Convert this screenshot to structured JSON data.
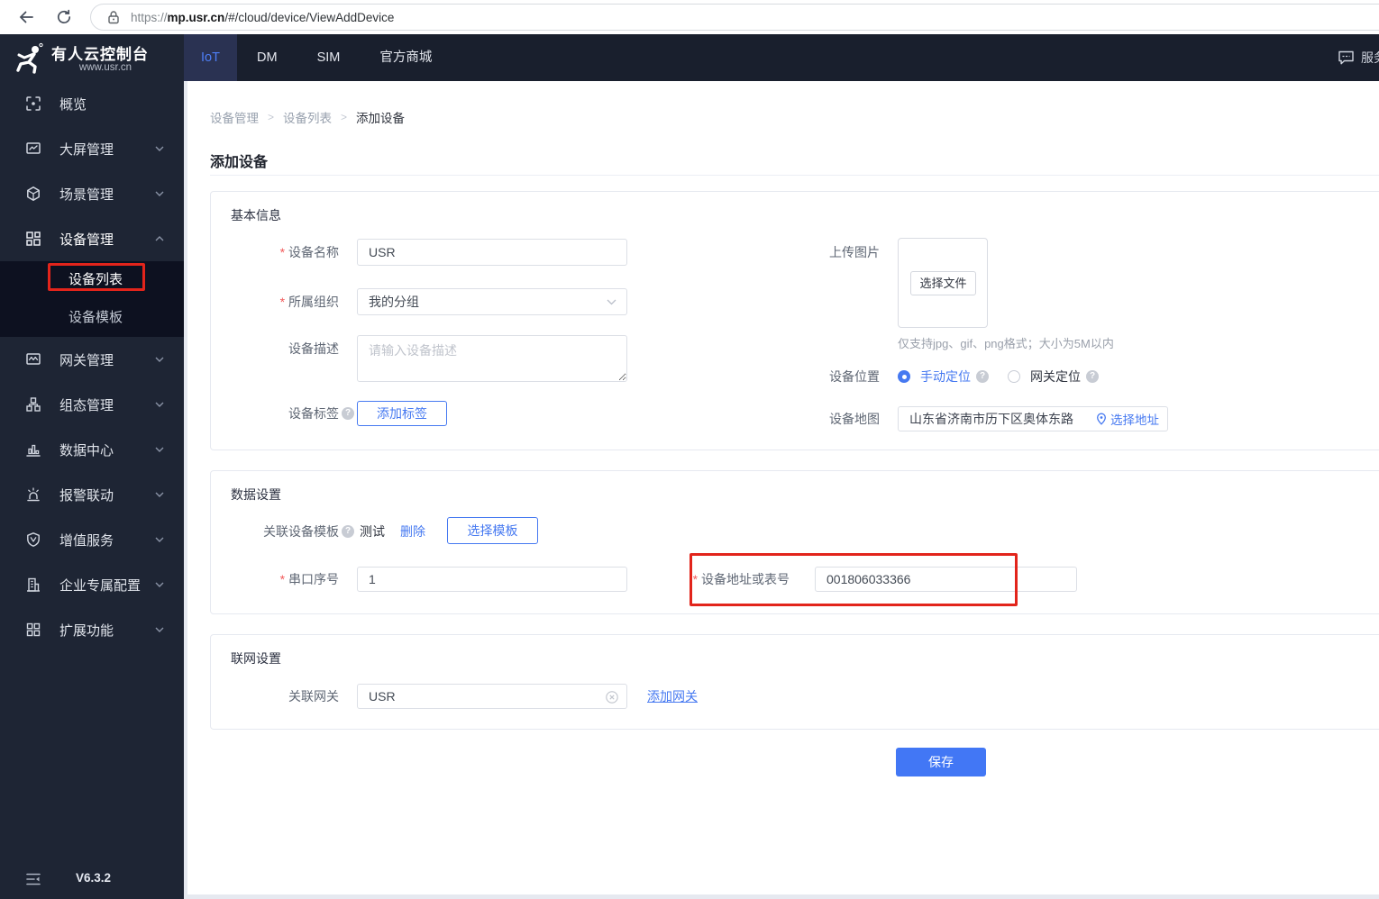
{
  "browser": {
    "url_scheme": "https://",
    "url_domain": "mp.usr.cn",
    "url_path": "/#/cloud/device/ViewAddDevice"
  },
  "brand": {
    "title": "有人云控制台",
    "subtitle": "www.usr.cn"
  },
  "topnav": {
    "tabs": [
      {
        "label": "IoT",
        "active": true
      },
      {
        "label": "DM",
        "active": false
      },
      {
        "label": "SIM",
        "active": false
      },
      {
        "label": "官方商城",
        "active": false
      }
    ],
    "service_label": "服务"
  },
  "sidebar": {
    "items": [
      {
        "label": "概览",
        "icon": "overview-icon",
        "chevron": "none"
      },
      {
        "label": "大屏管理",
        "icon": "bigscreen-icon",
        "chevron": "down"
      },
      {
        "label": "场景管理",
        "icon": "scene-icon",
        "chevron": "down"
      },
      {
        "label": "设备管理",
        "icon": "device-icon",
        "chevron": "up"
      },
      {
        "label": "网关管理",
        "icon": "gateway-icon",
        "chevron": "down"
      },
      {
        "label": "组态管理",
        "icon": "configuration-icon",
        "chevron": "down"
      },
      {
        "label": "数据中心",
        "icon": "datacenter-icon",
        "chevron": "down"
      },
      {
        "label": "报警联动",
        "icon": "alarm-icon",
        "chevron": "down"
      },
      {
        "label": "增值服务",
        "icon": "value-service-icon",
        "chevron": "down"
      },
      {
        "label": "企业专属配置",
        "icon": "enterprise-icon",
        "chevron": "down"
      },
      {
        "label": "扩展功能",
        "icon": "extension-icon",
        "chevron": "down"
      }
    ],
    "submenu": [
      {
        "label": "设备列表",
        "active": true
      },
      {
        "label": "设备模板",
        "active": false
      }
    ],
    "version": "V6.3.2"
  },
  "breadcrumb": {
    "items": [
      "设备管理",
      "设备列表",
      "添加设备"
    ]
  },
  "page_title": "添加设备",
  "basic_info": {
    "section_title": "基本信息",
    "device_name": {
      "label": "设备名称",
      "value": "USR"
    },
    "organization": {
      "label": "所属组织",
      "value": "我的分组"
    },
    "description": {
      "label": "设备描述",
      "placeholder": "请输入设备描述"
    },
    "tags": {
      "label": "设备标签",
      "button": "添加标签"
    },
    "upload": {
      "label": "上传图片",
      "button": "选择文件",
      "hint": "仅支持jpg、gif、png格式；大小为5M以内"
    },
    "location": {
      "label": "设备位置",
      "option_manual": "手动定位",
      "option_gateway": "网关定位",
      "selected": "手动定位"
    },
    "map": {
      "label": "设备地图",
      "value": "山东省济南市历下区奥体东路",
      "link": "选择地址"
    }
  },
  "data_settings": {
    "section_title": "数据设置",
    "template": {
      "label": "关联设备模板",
      "value": "测试",
      "delete_link": "删除",
      "select_button": "选择模板"
    },
    "serial": {
      "label": "串口序号",
      "value": "1"
    },
    "address": {
      "label": "设备地址或表号",
      "value": "001806033366"
    }
  },
  "network_settings": {
    "section_title": "联网设置",
    "gateway": {
      "label": "关联网关",
      "value": "USR",
      "add_link": "添加网关"
    }
  },
  "save_button": "保存",
  "colors": {
    "primary": "#4679f1",
    "annotation": "#e2241b"
  }
}
